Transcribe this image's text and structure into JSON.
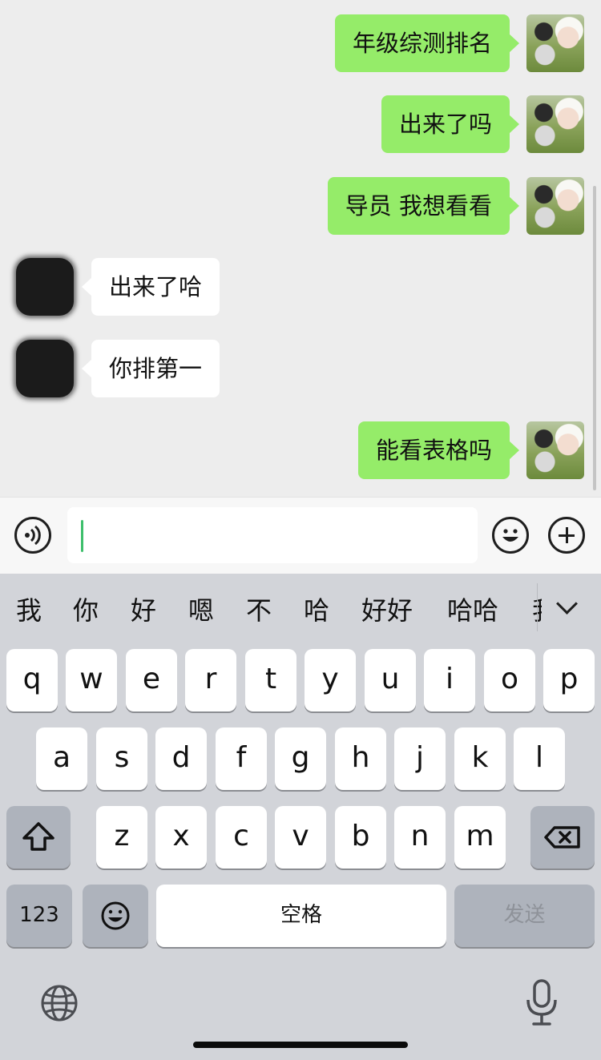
{
  "colors": {
    "my_bubble": "#95ec69",
    "their_bubble": "#ffffff",
    "chat_background": "#ededed",
    "keyboard_background": "#d2d4d9",
    "caret": "#3ebf6c"
  },
  "messages": [
    {
      "sender": "me",
      "text": "年级综测排名"
    },
    {
      "sender": "me",
      "text": "出来了吗"
    },
    {
      "sender": "me",
      "text": "导员 我想看看"
    },
    {
      "sender": "other",
      "text": "出来了哈"
    },
    {
      "sender": "other",
      "text": "你排第一"
    },
    {
      "sender": "me",
      "text": "能看表格吗"
    }
  ],
  "input_bar": {
    "voice_icon": "voice-icon",
    "text_value": "",
    "emoji_icon": "emoji-icon",
    "plus_icon": "plus-icon"
  },
  "keyboard": {
    "candidates": [
      "我",
      "你",
      "好",
      "嗯",
      "不",
      "哈",
      "好好",
      "哈哈",
      "我"
    ],
    "row1": [
      "q",
      "w",
      "e",
      "r",
      "t",
      "y",
      "u",
      "i",
      "o",
      "p"
    ],
    "row2": [
      "a",
      "s",
      "d",
      "f",
      "g",
      "h",
      "j",
      "k",
      "l"
    ],
    "row3": [
      "z",
      "x",
      "c",
      "v",
      "b",
      "n",
      "m"
    ],
    "numbers_label": "123",
    "space_label": "空格",
    "send_label": "发送"
  }
}
